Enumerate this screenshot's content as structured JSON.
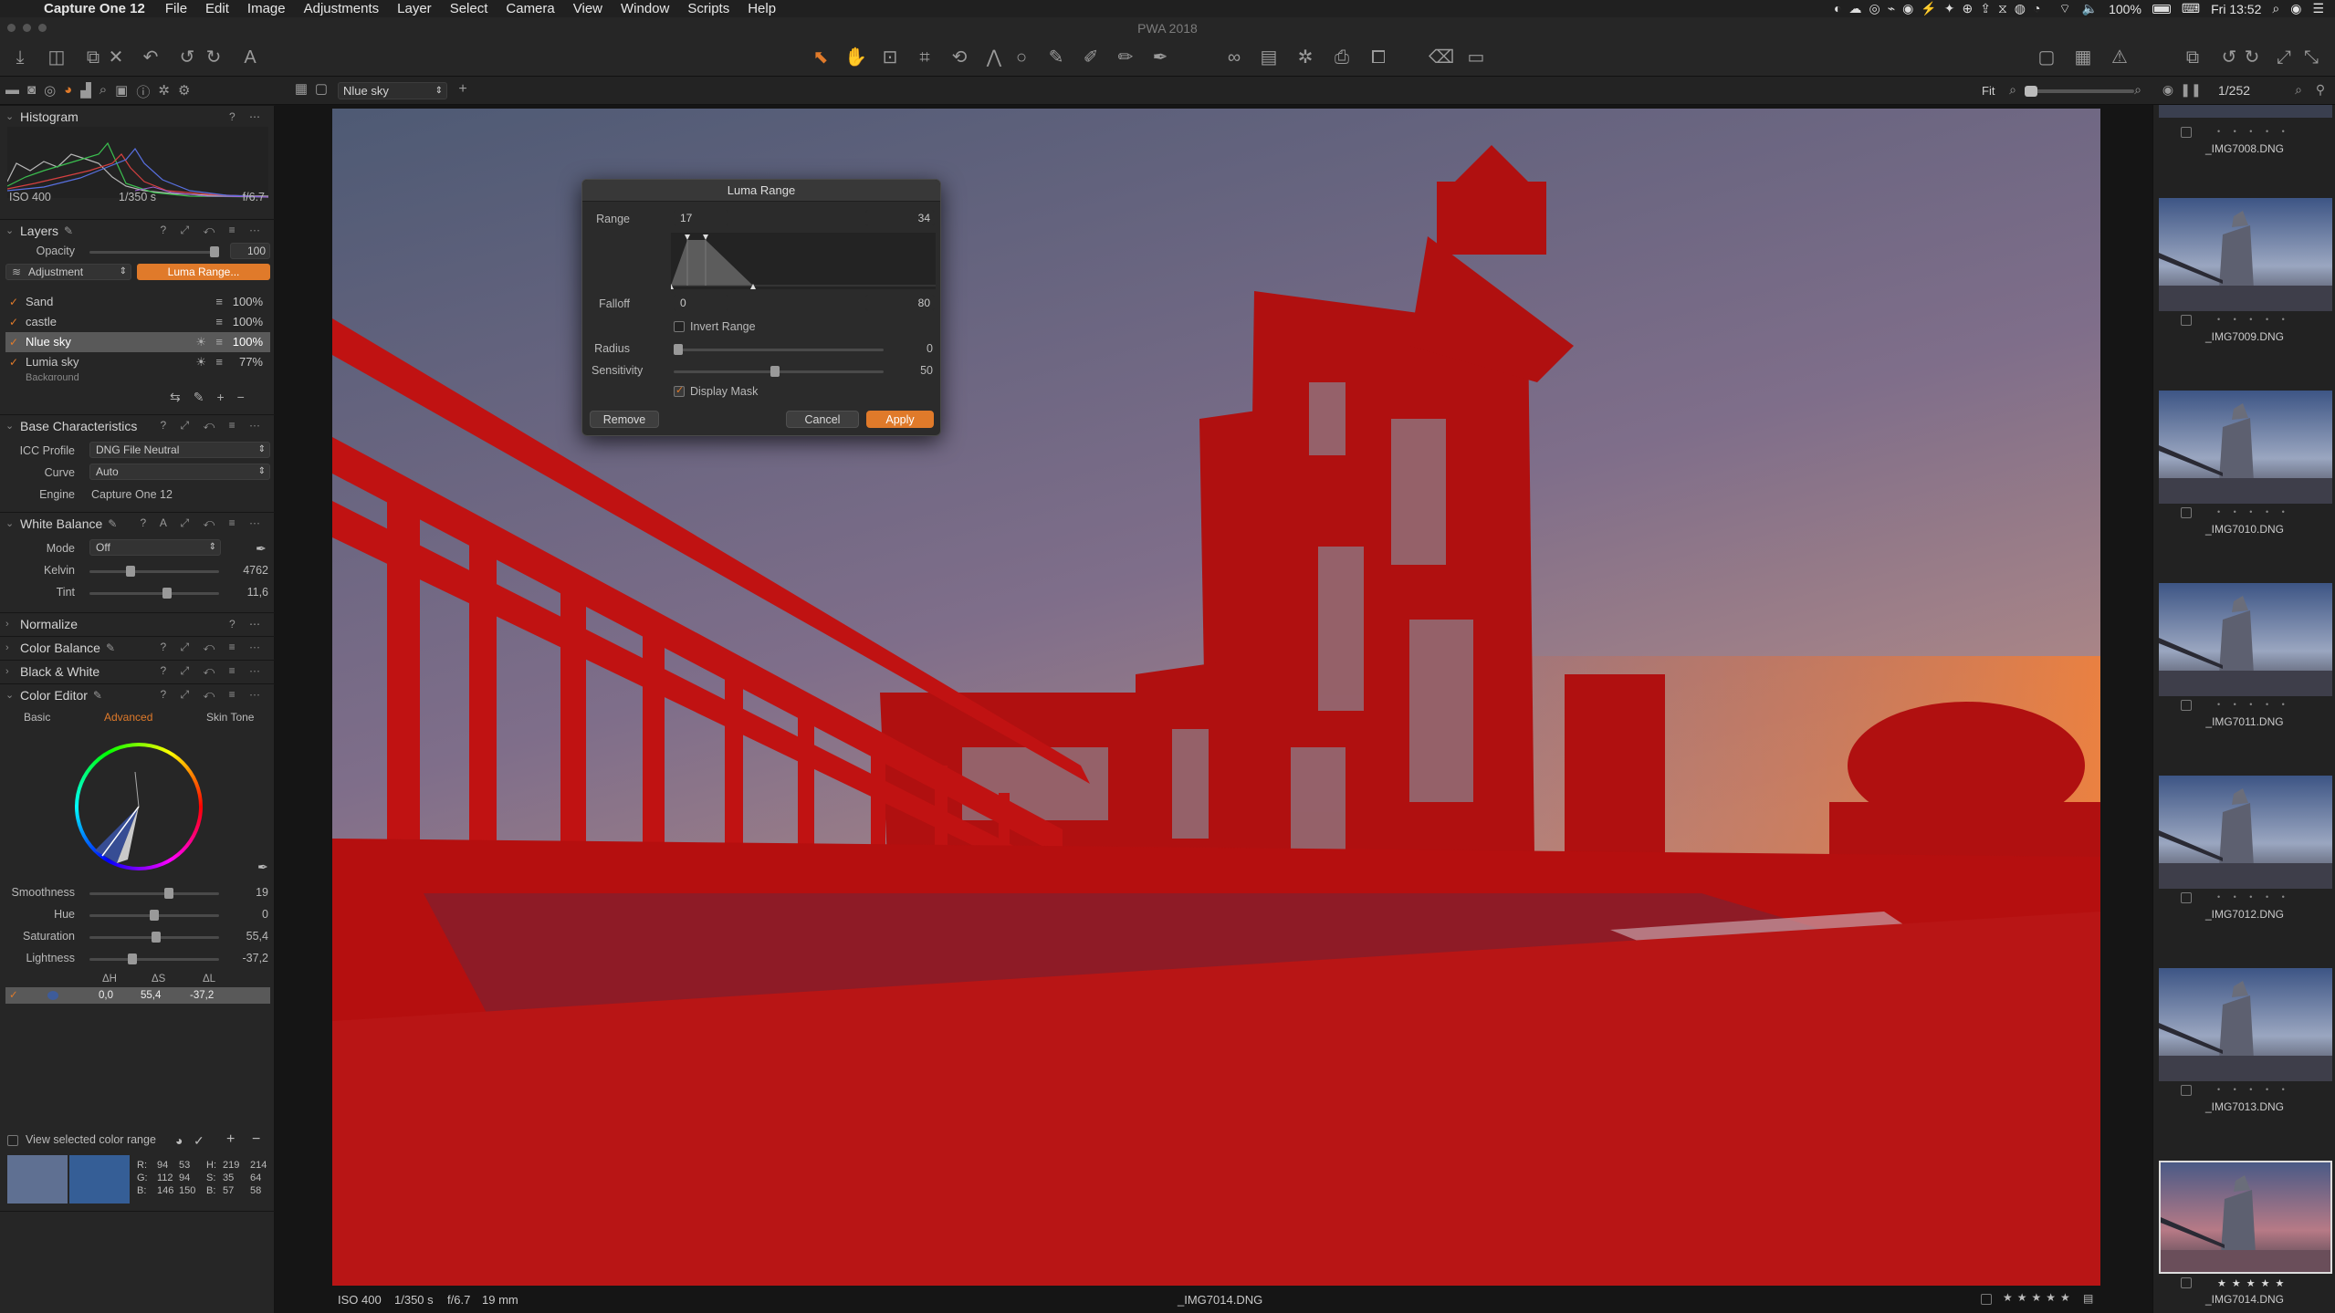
{
  "menubar": {
    "app_name": "Capture One 12",
    "items": [
      "File",
      "Edit",
      "Image",
      "Adjustments",
      "Layer",
      "Select",
      "Camera",
      "View",
      "Window",
      "Scripts",
      "Help"
    ],
    "battery": "100%",
    "clock": "Fri 13:52"
  },
  "window": {
    "title": "PWA 2018"
  },
  "subbar": {
    "layer_select": "Nlue sky",
    "zoom_label": "Fit",
    "browser_count": "1/252"
  },
  "histogram": {
    "title": "Histogram",
    "iso": "ISO 400",
    "shutter": "1/350 s",
    "aperture": "f/6.7"
  },
  "layers": {
    "title": "Layers",
    "opacity_label": "Opacity",
    "opacity_value": "100",
    "opacity_level": 1.0,
    "adjustment_label": "Adjustment",
    "luma_range_button": "Luma Range...",
    "items": [
      {
        "name": "Sand",
        "opacity": "100%"
      },
      {
        "name": "castle",
        "opacity": "100%"
      },
      {
        "name": "Nlue sky",
        "opacity": "100%"
      },
      {
        "name": "Lumia sky",
        "opacity": "77%"
      },
      {
        "name": "Background",
        "opacity": ""
      }
    ]
  },
  "base_characteristics": {
    "title": "Base Characteristics",
    "icc_label": "ICC Profile",
    "icc_value": "DNG File Neutral",
    "curve_label": "Curve",
    "curve_value": "Auto",
    "engine_label": "Engine",
    "engine_value": "Capture One 12"
  },
  "white_balance": {
    "title": "White Balance",
    "mode_label": "Mode",
    "mode_value": "Off",
    "kelvin_label": "Kelvin",
    "kelvin_value": "4762",
    "tint_label": "Tint",
    "tint_value": "11,6"
  },
  "collapsed_sections": [
    "Normalize",
    "Color Balance",
    "Black & White"
  ],
  "color_editor": {
    "title": "Color Editor",
    "tabs": [
      "Basic",
      "Advanced",
      "Skin Tone"
    ],
    "active_tab": "Advanced",
    "smoothness_label": "Smoothness",
    "smoothness_value": "19",
    "hue_label": "Hue",
    "hue_value": "0",
    "saturation_label": "Saturation",
    "saturation_value": "55,4",
    "lightness_label": "Lightness",
    "lightness_value": "-37,2",
    "delta_headers": [
      "ΔH",
      "ΔS",
      "ΔL"
    ],
    "delta_row": [
      "0,0",
      "55,4",
      "-37,2"
    ],
    "view_selected_label": "View selected color range",
    "readout": {
      "r": "R:",
      "g": "G:",
      "b": "B:",
      "r1": "94",
      "g1": "112",
      "b1": "146",
      "r2": "53",
      "g2": "94",
      "b2": "150",
      "h_label": "H:",
      "s_label": "S:",
      "b2_label": "B:",
      "h1": "219",
      "s1": "35",
      "bb1": "57",
      "h2": "214",
      "s2": "64",
      "bb2": "58"
    },
    "swatch_before": "#5f7092",
    "swatch_after": "#355e96"
  },
  "luma_dialog": {
    "title": "Luma Range",
    "range_label": "Range",
    "range_low": "17",
    "range_high": "34",
    "falloff_label": "Falloff",
    "falloff_low": "0",
    "falloff_high": "80",
    "invert_label": "Invert Range",
    "radius_label": "Radius",
    "radius_value": "0",
    "sensitivity_label": "Sensitivity",
    "sensitivity_value": "50",
    "display_mask_label": "Display Mask",
    "remove_label": "Remove",
    "cancel_label": "Cancel",
    "apply_label": "Apply"
  },
  "filmstrip": {
    "items": [
      {
        "name": "_IMG7008.DNG"
      },
      {
        "name": "_IMG7009.DNG"
      },
      {
        "name": "_IMG7010.DNG"
      },
      {
        "name": "_IMG7011.DNG"
      },
      {
        "name": "_IMG7012.DNG"
      },
      {
        "name": "_IMG7013.DNG"
      },
      {
        "name": "_IMG7014.DNG"
      }
    ]
  },
  "statusbar": {
    "iso": "ISO 400",
    "shutter": "1/350 s",
    "aperture": "f/6.7",
    "focal": "19 mm",
    "filename": "_IMG7014.DNG"
  },
  "colors": {
    "accent": "#e07a2a",
    "mask_red": "#b00000"
  }
}
